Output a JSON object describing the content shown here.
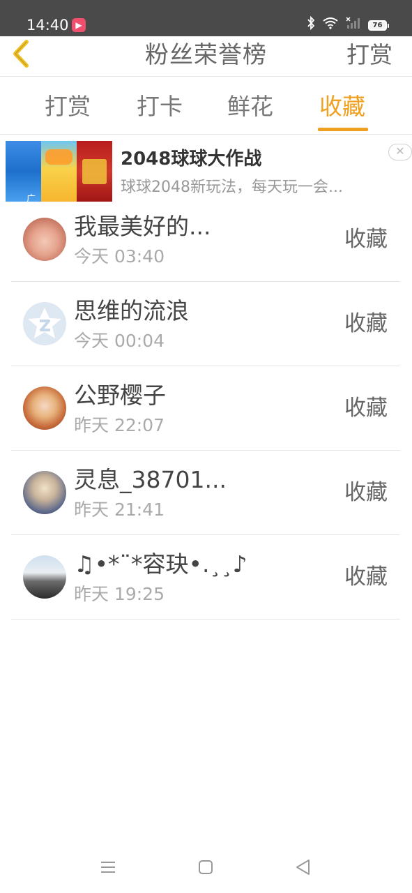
{
  "status_bar": {
    "time": "14:40",
    "battery": "76",
    "icons": [
      "bluetooth-icon",
      "wifi-icon",
      "signal-icon"
    ]
  },
  "nav": {
    "title": "粉丝荣誉榜",
    "action_label": "打赏",
    "back_icon": "chevron-left-icon",
    "accent_color": "#f0c020"
  },
  "tabs": [
    {
      "label": "打赏"
    },
    {
      "label": "打卡"
    },
    {
      "label": "鲜花"
    },
    {
      "label": "收藏",
      "active": true
    }
  ],
  "ad": {
    "title": "2048球球大作战",
    "description": "球球2048新玩法，每天玩一会...",
    "badge": "广告"
  },
  "list": [
    {
      "name": "我最美好的...",
      "time": "今天 03:40",
      "action": "收藏"
    },
    {
      "name": "思维的流浪",
      "time": "今天 00:04",
      "action": "收藏"
    },
    {
      "name": "公野樱子",
      "time": "昨天 22:07",
      "action": "收藏"
    },
    {
      "name": "灵息_38701...",
      "time": "昨天 21:41",
      "action": "收藏"
    },
    {
      "name": "♫•*¨*容玦•.¸¸♪",
      "time": "昨天 19:25",
      "action": "收藏"
    }
  ],
  "colors": {
    "active_tab": "#f0a020",
    "status_bar_bg": "#4a4a4a"
  }
}
